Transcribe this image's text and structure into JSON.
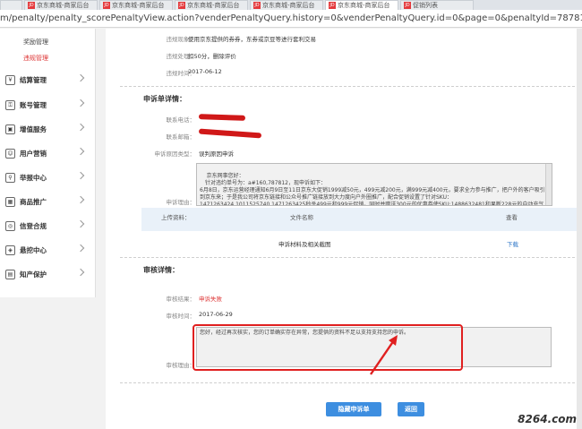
{
  "browser": {
    "tabs": [
      "",
      "京东商城-商家后台",
      "京东商城-商家后台",
      "京东商城-商家后台",
      "京东商城-商家后台",
      "京东商城-商家后台",
      "促销列表"
    ],
    "active_tab": 5,
    "url": "m/penalty/penalty_scorePenaltyView.action?venderPenaltyQuery.history=0&venderPenaltyQuery.id=0&page=0&penaltyId=787812&type=5&operatetype=1"
  },
  "sidebar": {
    "subitems": [
      "奖励管理",
      "违规管理"
    ],
    "items": [
      {
        "label": "结算管理",
        "icon": "settlement-icon"
      },
      {
        "label": "账号管理",
        "icon": "account-icon"
      },
      {
        "label": "增值服务",
        "icon": "value-added-icon"
      },
      {
        "label": "用户营销",
        "icon": "user-marketing-icon"
      },
      {
        "label": "举报中心",
        "icon": "report-icon"
      },
      {
        "label": "商品推广",
        "icon": "promotion-icon"
      },
      {
        "label": "信登合规",
        "icon": "compliance-icon"
      },
      {
        "label": "悬挖中心",
        "icon": "shield-icon"
      },
      {
        "label": "知产保护",
        "icon": "ip-protection-icon"
      }
    ]
  },
  "violation": {
    "phenomenon_label": "违规现象：",
    "phenomenon_value": "使用京东提供的券券，东券或京豆等进行套利交易",
    "handling_label": "违规处理：",
    "handling_value": "扣50分，删除评价",
    "time_label": "违规时间：",
    "time_value": "2017-06-12"
  },
  "appeal": {
    "title": "申诉单详情：",
    "phone_label": "联系电话：",
    "email_label": "联系邮箱：",
    "reason_type_label": "申诉原因类型：",
    "reason_type_value": "误判原因申诉",
    "reason_label": "申诉理由：",
    "reason_text": "京东网事您好：\n　针对违约单号为：a#160,787812，现申诉如下：\n6月8日，京东运营经理通知6月9日至11日京东大促销1999减50元，499元减200元，满999元减400元，要求全力参与推广，把户外的客户吸引到京东来；于是我公司将京东链接和公众号推广链接放到大力度向户外圈推广，配合促销设置了针对SKU：1471263424,1011525740,1471263425秒杀499元和999元促销，同时并赠送300元的优惠券使SKU:1488632481和果断228元的自动充气枕",
    "upload_label": "上传资料：",
    "col_filename": "文件名称",
    "col_view": "查看",
    "file_name": "申诉材料及相关截图",
    "download": "下载"
  },
  "review": {
    "title": "审核详情：",
    "result_label": "审核结果：",
    "result_value": "申诉失败",
    "time_label": "审核时间：",
    "time_value": "2017-06-29",
    "reason_label": "审核理由：",
    "reason_text": "您好，经过再次核实，您的订单确实存在异常，您提供的资料不足以支持支持您的申诉。"
  },
  "buttons": {
    "hide": "隐藏申诉单",
    "back": "返回"
  },
  "watermark": "8264.com",
  "colors": {
    "accent": "#3d8ee0",
    "fail": "#d33",
    "annotation": "#e02020"
  }
}
